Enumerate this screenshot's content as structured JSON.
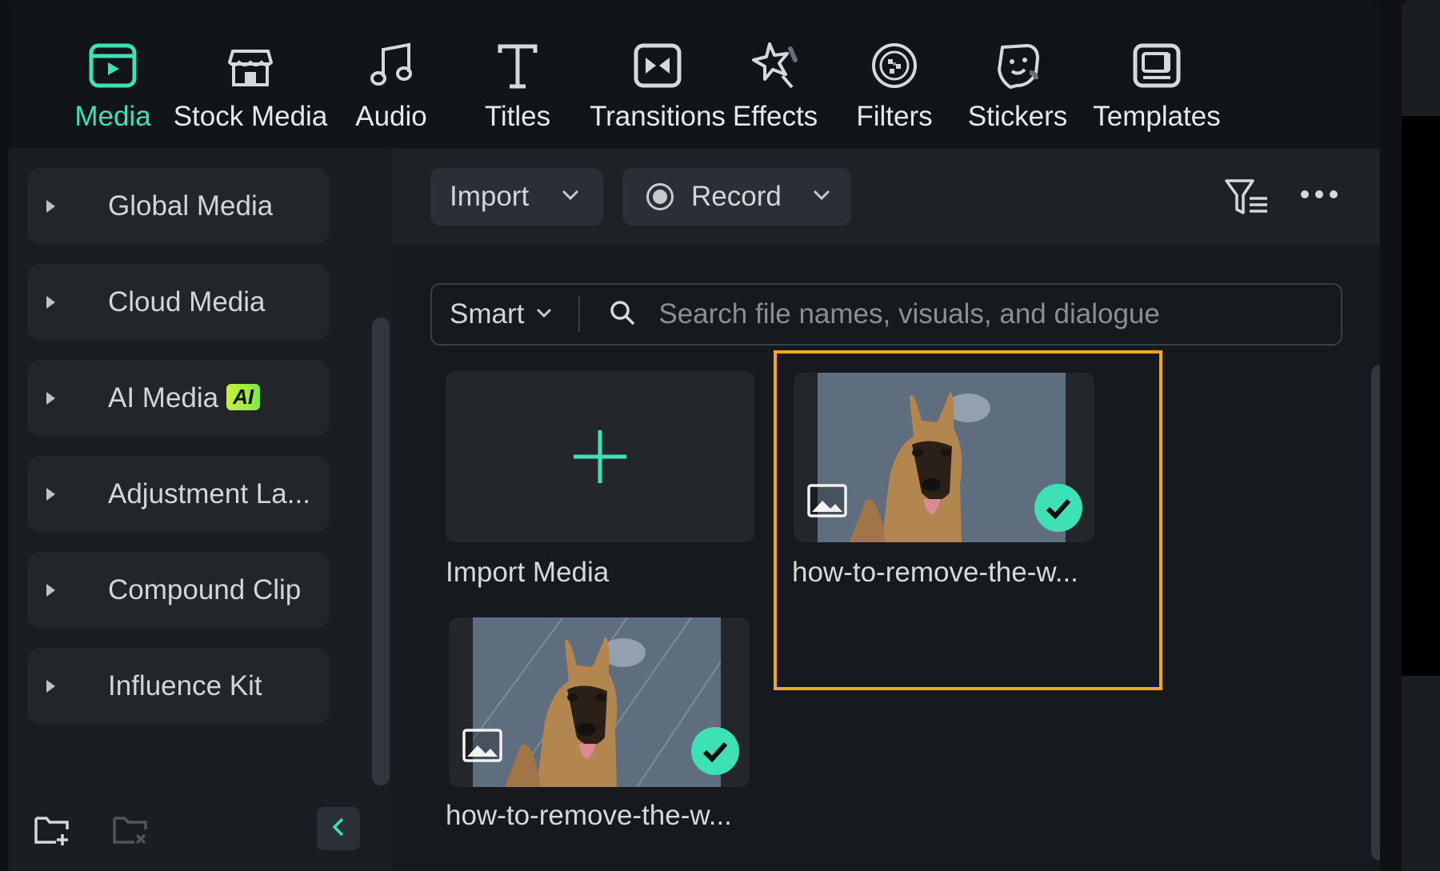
{
  "toolbar": {
    "items": [
      {
        "label": "Media",
        "icon": "media-icon"
      },
      {
        "label": "Stock Media",
        "icon": "stock-media-icon"
      },
      {
        "label": "Audio",
        "icon": "music-note-icon"
      },
      {
        "label": "Titles",
        "icon": "text-t-icon"
      },
      {
        "label": "Transitions",
        "icon": "transition-icon"
      },
      {
        "label": "Effects",
        "icon": "sparkle-star-icon"
      },
      {
        "label": "Filters",
        "icon": "filter-circle-icon"
      },
      {
        "label": "Stickers",
        "icon": "sticker-face-icon"
      },
      {
        "label": "Templates",
        "icon": "template-icon"
      }
    ],
    "active": "Media",
    "accent": "#3ee0b6"
  },
  "sidebar": {
    "items": [
      {
        "label": "Global Media"
      },
      {
        "label": "Cloud Media"
      },
      {
        "label": "AI Media",
        "badge": "AI"
      },
      {
        "label": "Adjustment La..."
      },
      {
        "label": "Compound Clip"
      },
      {
        "label": "Influence Kit"
      }
    ],
    "footer_icons": [
      "new-folder-icon",
      "remove-folder-icon",
      "collapse-left-icon"
    ]
  },
  "main": {
    "import_label": "Import",
    "record_label": "Record",
    "filter_icon": "filter-sort-icon",
    "more_icon": "more-dots-icon",
    "search": {
      "mode": "Smart",
      "placeholder": "Search file names, visuals, and dialogue"
    },
    "cards": [
      {
        "name": "Import Media",
        "type": "import"
      },
      {
        "name": "how-to-remove-the-w...",
        "type": "image",
        "checked": true,
        "selected": true
      },
      {
        "name": "how-to-remove-the-w...",
        "type": "image",
        "checked": true,
        "watermarked": true
      }
    ],
    "highlight_color": "#f5a623"
  }
}
